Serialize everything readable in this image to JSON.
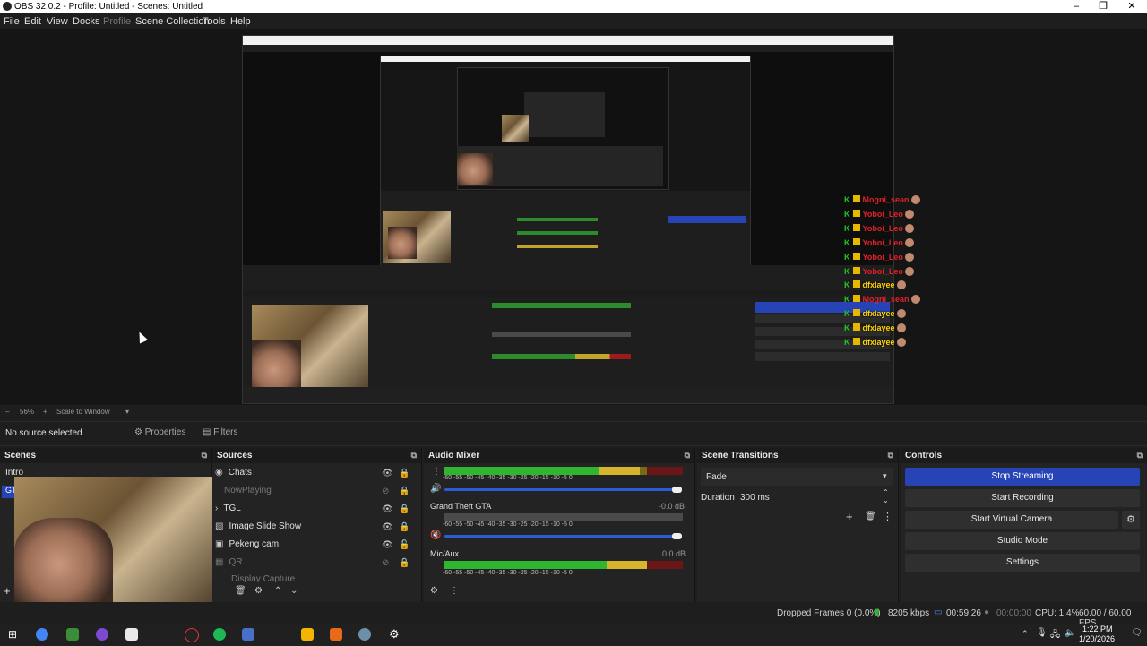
{
  "window": {
    "title": "OBS 32.0.2 - Profile: Untitled - Scenes: Untitled"
  },
  "menu": [
    "File",
    "Edit",
    "View",
    "Docks",
    "Profile",
    "Scene Collection",
    "Tools",
    "Help"
  ],
  "preview": {
    "zoom": "56%",
    "scale_mode": "Scale to Window",
    "chat": [
      {
        "user": "Mogni_sean",
        "self": false
      },
      {
        "user": "Yoboi_Leo",
        "self": false
      },
      {
        "user": "Yoboi_Leo",
        "self": false
      },
      {
        "user": "Yoboi_Leo",
        "self": false
      },
      {
        "user": "Yoboi_Leo",
        "self": false
      },
      {
        "user": "Yoboi_Leo",
        "self": false
      },
      {
        "user": "dfxlayee",
        "self": true
      },
      {
        "user": "Mogni_sean",
        "self": false
      },
      {
        "user": "dfxlayee",
        "self": true
      },
      {
        "user": "dfxlayee",
        "self": true
      },
      {
        "user": "dfxlayee",
        "self": true
      }
    ]
  },
  "source_bar": {
    "status": "No source selected",
    "properties": "Properties",
    "filters": "Filters"
  },
  "scenes": {
    "title": "Scenes",
    "items": [
      "Intro",
      "GTA"
    ]
  },
  "sources": {
    "title": "Sources",
    "items": [
      {
        "name": "Chats",
        "visible": true
      },
      {
        "name": "NowPlaying",
        "visible": false
      },
      {
        "name": "TGL",
        "visible": true
      },
      {
        "name": "Image Slide Show",
        "visible": true
      },
      {
        "name": "Pekeng cam",
        "visible": true
      },
      {
        "name": "QR",
        "visible": false
      },
      {
        "name": "Display Capture",
        "visible": false
      }
    ]
  },
  "mixer": {
    "title": "Audio Mixer",
    "ticks": "-60  -55  -50  -45  -40  -35  -30  -25  -20  -15  -10  -5  0",
    "channels": [
      {
        "name": "",
        "db": "",
        "level": 0.82
      },
      {
        "name": "Grand Theft GTA",
        "db": "-0.0 dB",
        "level": 0.0
      },
      {
        "name": "Mic/Aux",
        "db": "0.0 dB",
        "level": 0.9
      }
    ]
  },
  "transitions": {
    "title": "Scene Transitions",
    "selected": "Fade",
    "duration_label": "Duration",
    "duration": "300 ms"
  },
  "controls": {
    "title": "Controls",
    "buttons": [
      "Stop Streaming",
      "Start Recording",
      "Start Virtual Camera",
      "Studio Mode",
      "Settings"
    ]
  },
  "status": {
    "dropped": "Dropped Frames 0 (0.0%)",
    "kbps": "8205 kbps",
    "stream_time": "00:59:26",
    "rec_time": "00:00:00",
    "cpu": "CPU: 1.4%",
    "fps": "60.00 / 60.00 FPS"
  },
  "taskbar": {
    "time": "1:22 PM",
    "date": "1/20/2026"
  },
  "colors": {
    "accent": "#2644b5",
    "bg": "#1e1e1e",
    "dock": "#232323"
  }
}
